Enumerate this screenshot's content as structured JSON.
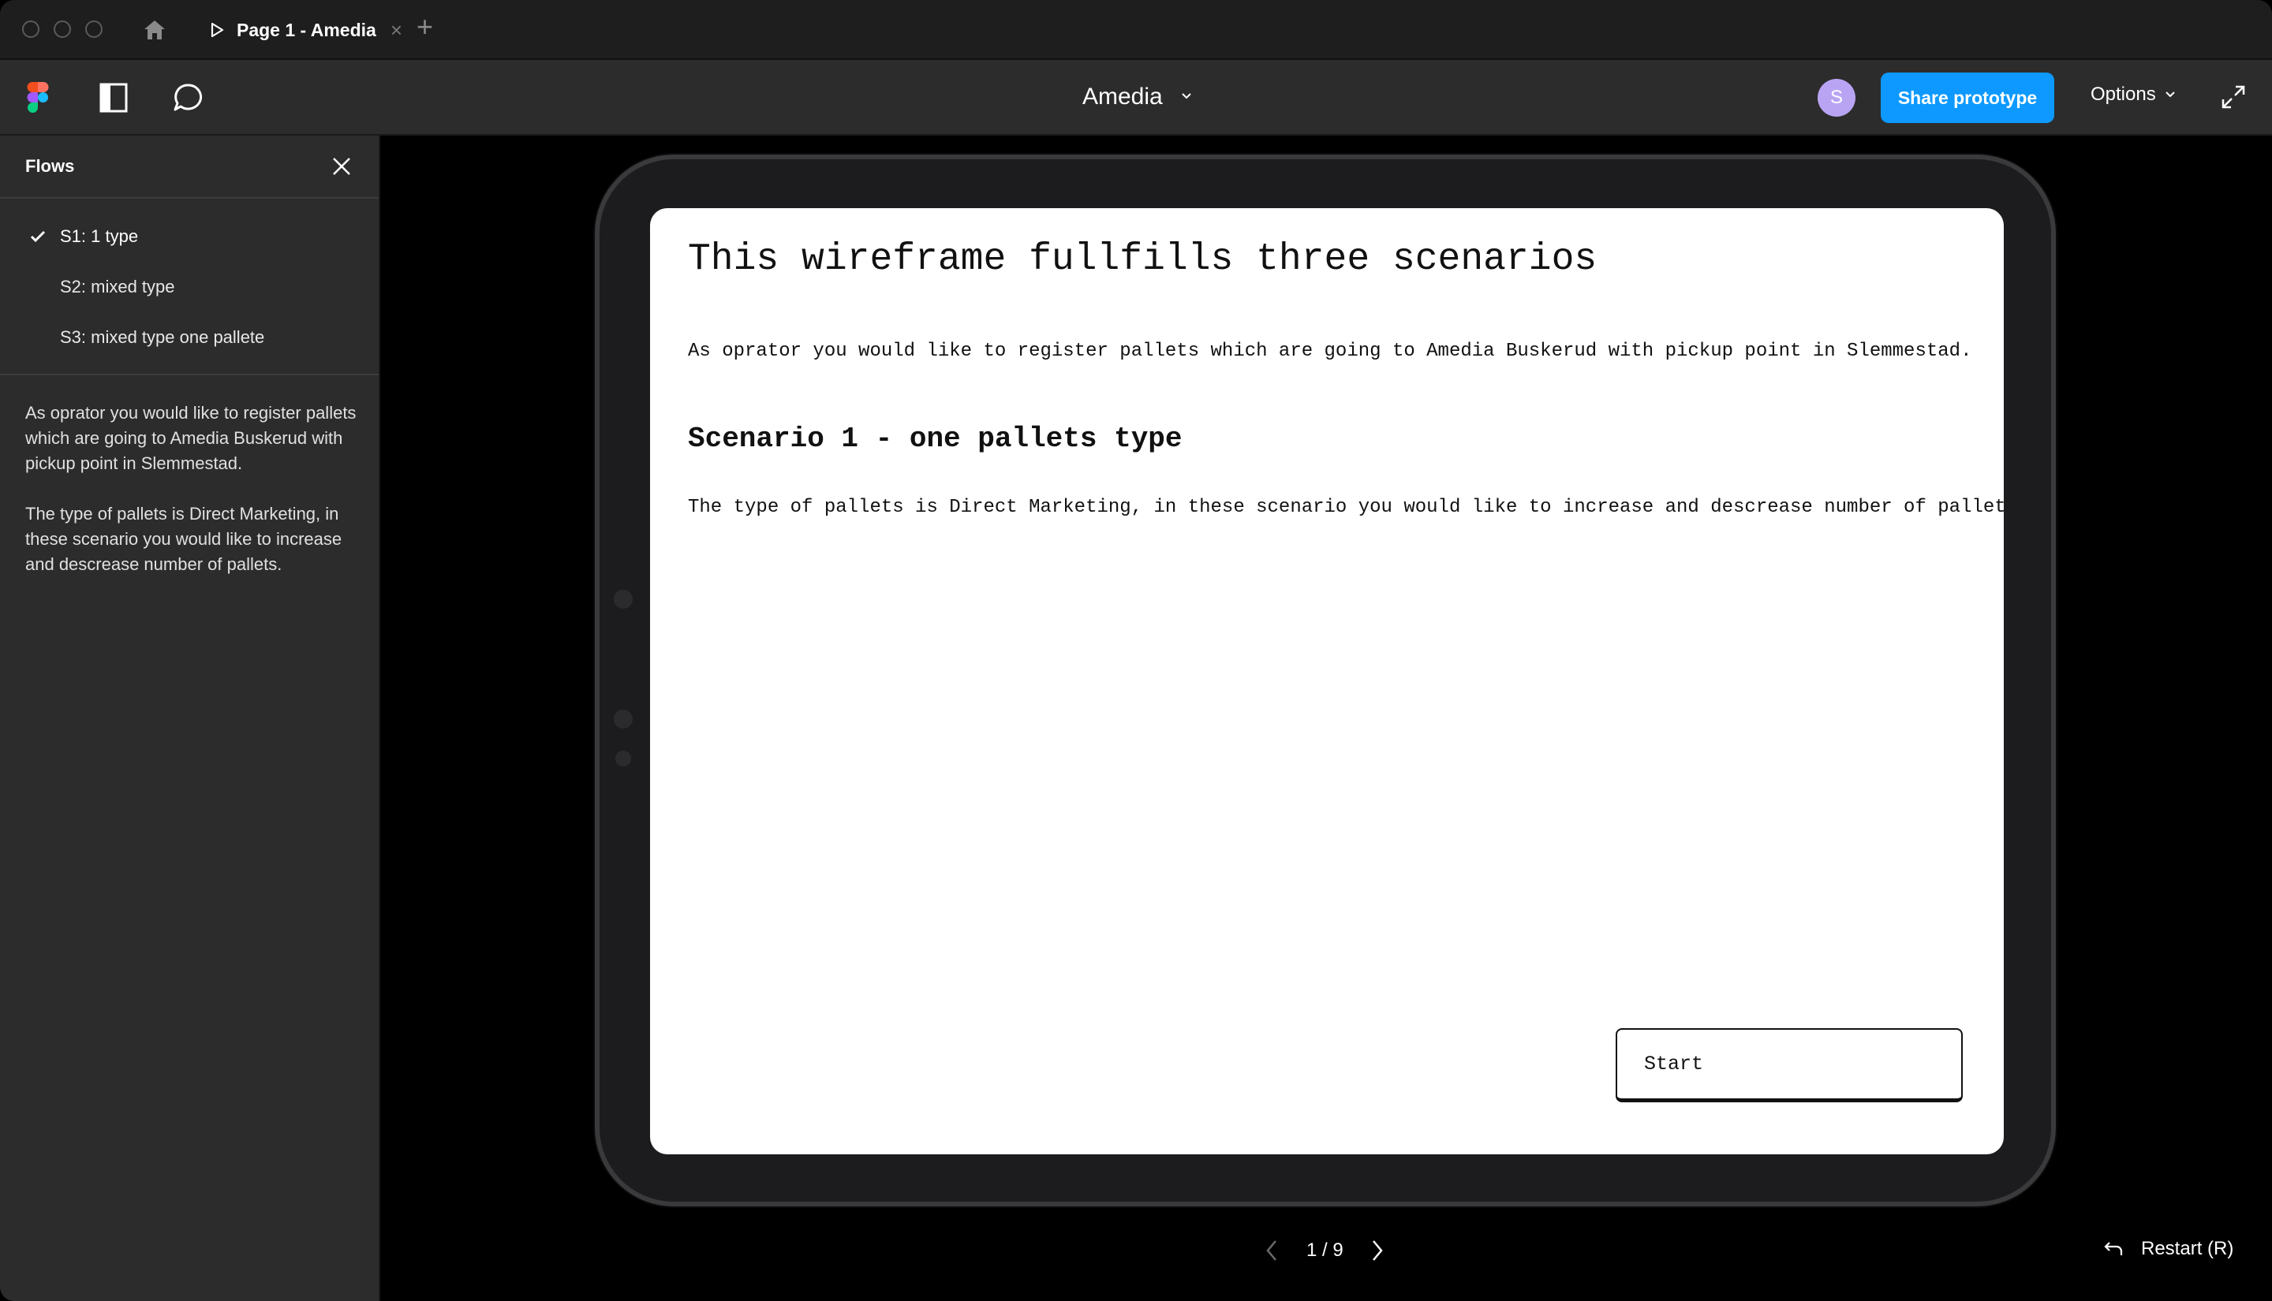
{
  "tab": {
    "title": "Page 1 - Amedia"
  },
  "toolbar": {
    "file_name": "Amedia",
    "avatar_initial": "S",
    "share_label": "Share prototype",
    "options_label": "Options"
  },
  "sidebar": {
    "title": "Flows",
    "flows": [
      {
        "label": "S1: 1 type",
        "active": true
      },
      {
        "label": "S2: mixed type",
        "active": false
      },
      {
        "label": "S3: mixed type one pallete",
        "active": false
      }
    ],
    "description": [
      "As oprator you would like to register pallets which are going to Amedia Buskerud with pickup point in Slemmestad.",
      "The type of pallets is Direct Marketing, in these scenario you would like to increase and descrease number of pallets."
    ]
  },
  "screen": {
    "title": "This wireframe fullfills three scenarios",
    "intro": "As oprator you would like to register pallets which are going to Amedia Buskerud with pickup point in Slemmestad.",
    "scenario_heading": "Scenario 1 - one pallets type",
    "scenario_body": "The type of pallets is Direct Marketing, in these scenario you would like to increase and descrease number of pallets.",
    "start_label": "Start"
  },
  "pager": {
    "text": "1 / 9"
  },
  "restart_label": "Restart (R)",
  "colors": {
    "accent": "#0d99ff",
    "avatar": "#b9a4f4",
    "toolbar": "#2c2c2c",
    "titlebar": "#1e1e1e"
  }
}
